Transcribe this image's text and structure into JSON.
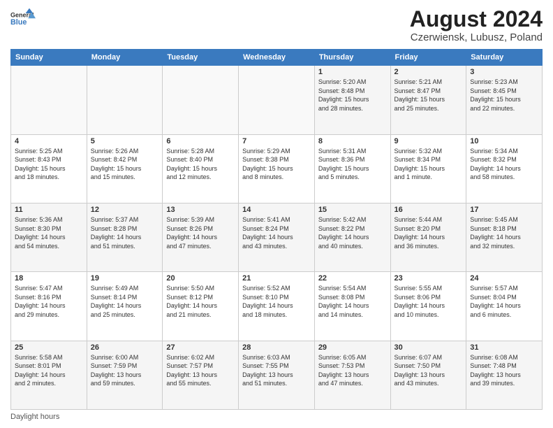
{
  "header": {
    "logo_line1": "General",
    "logo_line2": "Blue",
    "title": "August 2024",
    "subtitle": "Czerwiensk, Lubusz, Poland"
  },
  "days_of_week": [
    "Sunday",
    "Monday",
    "Tuesday",
    "Wednesday",
    "Thursday",
    "Friday",
    "Saturday"
  ],
  "weeks": [
    [
      {
        "day": "",
        "info": ""
      },
      {
        "day": "",
        "info": ""
      },
      {
        "day": "",
        "info": ""
      },
      {
        "day": "",
        "info": ""
      },
      {
        "day": "1",
        "info": "Sunrise: 5:20 AM\nSunset: 8:48 PM\nDaylight: 15 hours\nand 28 minutes."
      },
      {
        "day": "2",
        "info": "Sunrise: 5:21 AM\nSunset: 8:47 PM\nDaylight: 15 hours\nand 25 minutes."
      },
      {
        "day": "3",
        "info": "Sunrise: 5:23 AM\nSunset: 8:45 PM\nDaylight: 15 hours\nand 22 minutes."
      }
    ],
    [
      {
        "day": "4",
        "info": "Sunrise: 5:25 AM\nSunset: 8:43 PM\nDaylight: 15 hours\nand 18 minutes."
      },
      {
        "day": "5",
        "info": "Sunrise: 5:26 AM\nSunset: 8:42 PM\nDaylight: 15 hours\nand 15 minutes."
      },
      {
        "day": "6",
        "info": "Sunrise: 5:28 AM\nSunset: 8:40 PM\nDaylight: 15 hours\nand 12 minutes."
      },
      {
        "day": "7",
        "info": "Sunrise: 5:29 AM\nSunset: 8:38 PM\nDaylight: 15 hours\nand 8 minutes."
      },
      {
        "day": "8",
        "info": "Sunrise: 5:31 AM\nSunset: 8:36 PM\nDaylight: 15 hours\nand 5 minutes."
      },
      {
        "day": "9",
        "info": "Sunrise: 5:32 AM\nSunset: 8:34 PM\nDaylight: 15 hours\nand 1 minute."
      },
      {
        "day": "10",
        "info": "Sunrise: 5:34 AM\nSunset: 8:32 PM\nDaylight: 14 hours\nand 58 minutes."
      }
    ],
    [
      {
        "day": "11",
        "info": "Sunrise: 5:36 AM\nSunset: 8:30 PM\nDaylight: 14 hours\nand 54 minutes."
      },
      {
        "day": "12",
        "info": "Sunrise: 5:37 AM\nSunset: 8:28 PM\nDaylight: 14 hours\nand 51 minutes."
      },
      {
        "day": "13",
        "info": "Sunrise: 5:39 AM\nSunset: 8:26 PM\nDaylight: 14 hours\nand 47 minutes."
      },
      {
        "day": "14",
        "info": "Sunrise: 5:41 AM\nSunset: 8:24 PM\nDaylight: 14 hours\nand 43 minutes."
      },
      {
        "day": "15",
        "info": "Sunrise: 5:42 AM\nSunset: 8:22 PM\nDaylight: 14 hours\nand 40 minutes."
      },
      {
        "day": "16",
        "info": "Sunrise: 5:44 AM\nSunset: 8:20 PM\nDaylight: 14 hours\nand 36 minutes."
      },
      {
        "day": "17",
        "info": "Sunrise: 5:45 AM\nSunset: 8:18 PM\nDaylight: 14 hours\nand 32 minutes."
      }
    ],
    [
      {
        "day": "18",
        "info": "Sunrise: 5:47 AM\nSunset: 8:16 PM\nDaylight: 14 hours\nand 29 minutes."
      },
      {
        "day": "19",
        "info": "Sunrise: 5:49 AM\nSunset: 8:14 PM\nDaylight: 14 hours\nand 25 minutes."
      },
      {
        "day": "20",
        "info": "Sunrise: 5:50 AM\nSunset: 8:12 PM\nDaylight: 14 hours\nand 21 minutes."
      },
      {
        "day": "21",
        "info": "Sunrise: 5:52 AM\nSunset: 8:10 PM\nDaylight: 14 hours\nand 18 minutes."
      },
      {
        "day": "22",
        "info": "Sunrise: 5:54 AM\nSunset: 8:08 PM\nDaylight: 14 hours\nand 14 minutes."
      },
      {
        "day": "23",
        "info": "Sunrise: 5:55 AM\nSunset: 8:06 PM\nDaylight: 14 hours\nand 10 minutes."
      },
      {
        "day": "24",
        "info": "Sunrise: 5:57 AM\nSunset: 8:04 PM\nDaylight: 14 hours\nand 6 minutes."
      }
    ],
    [
      {
        "day": "25",
        "info": "Sunrise: 5:58 AM\nSunset: 8:01 PM\nDaylight: 14 hours\nand 2 minutes."
      },
      {
        "day": "26",
        "info": "Sunrise: 6:00 AM\nSunset: 7:59 PM\nDaylight: 13 hours\nand 59 minutes."
      },
      {
        "day": "27",
        "info": "Sunrise: 6:02 AM\nSunset: 7:57 PM\nDaylight: 13 hours\nand 55 minutes."
      },
      {
        "day": "28",
        "info": "Sunrise: 6:03 AM\nSunset: 7:55 PM\nDaylight: 13 hours\nand 51 minutes."
      },
      {
        "day": "29",
        "info": "Sunrise: 6:05 AM\nSunset: 7:53 PM\nDaylight: 13 hours\nand 47 minutes."
      },
      {
        "day": "30",
        "info": "Sunrise: 6:07 AM\nSunset: 7:50 PM\nDaylight: 13 hours\nand 43 minutes."
      },
      {
        "day": "31",
        "info": "Sunrise: 6:08 AM\nSunset: 7:48 PM\nDaylight: 13 hours\nand 39 minutes."
      }
    ]
  ],
  "footer": "Daylight hours"
}
